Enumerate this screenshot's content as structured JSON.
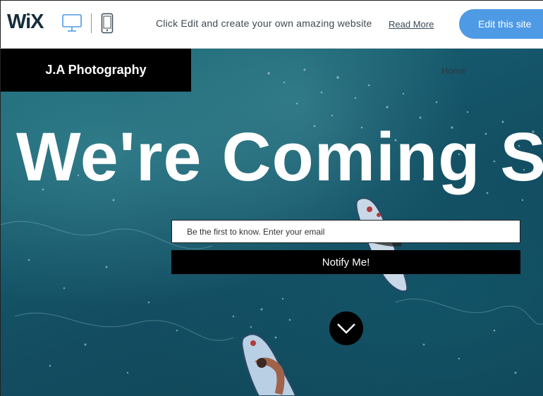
{
  "topbar": {
    "logo": "WiX",
    "promo_text": "Click Edit and create your own amazing website",
    "read_more": "Read More",
    "edit_button": "Edit this site",
    "icons": [
      "desktop-icon",
      "mobile-icon"
    ],
    "accent_color": "#4e9ae5"
  },
  "site": {
    "brand": "J.A Photography",
    "nav": {
      "home": "Home"
    },
    "headline": "We're Coming S",
    "signup": {
      "placeholder": "Be the first to know. Enter your email",
      "button": "Notify Me!"
    },
    "scroll_icon": "chevron-down-icon"
  }
}
